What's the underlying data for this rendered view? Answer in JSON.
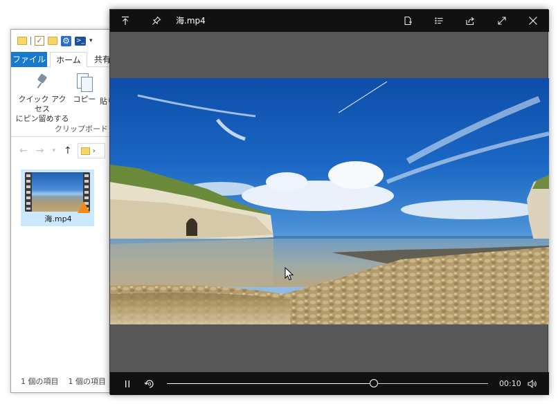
{
  "explorer": {
    "tabs": {
      "file": "ファイル",
      "home": "ホーム",
      "share": "共有"
    },
    "ribbon": {
      "pin_label_line1": "クイック アクセス",
      "pin_label_line2": "にピン留めする",
      "copy_label": "コピー",
      "paste_label": "貼り",
      "group_label": "クリップボード"
    },
    "file": {
      "name": "海.mp4"
    },
    "status": {
      "count_1": "1 個の項目",
      "count_2": "1 個の項目"
    }
  },
  "player": {
    "title": "海.mp4",
    "time": "00:10",
    "progress": 0.645,
    "icons": {
      "keep_on_top": "keep-on-top-icon",
      "pin": "pin-icon",
      "file": "file-icon",
      "playlist": "playlist-icon",
      "share": "share-icon",
      "fullscreen": "fullscreen-icon",
      "close": "close-icon",
      "pause": "pause-icon",
      "repeat": "repeat-icon",
      "volume": "volume-icon"
    }
  },
  "colors": {
    "accent_blue": "#1979ca",
    "player_bar": "#111111",
    "player_bg": "#575757",
    "selection": "#cce8ff"
  }
}
